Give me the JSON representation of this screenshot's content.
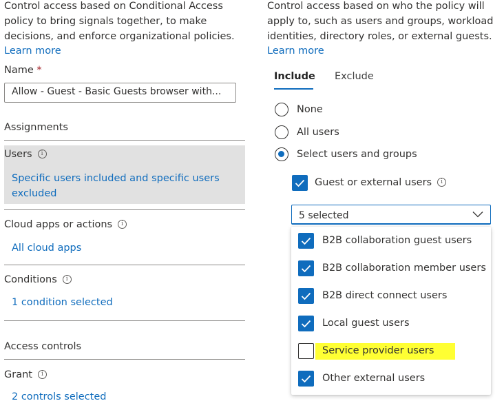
{
  "left": {
    "description": [
      "Control access based on Conditional Access",
      "policy to bring signals together, to make",
      "decisions, and enforce organizational policies."
    ],
    "learn_more": "Learn more",
    "name_label": "Name",
    "required_mark": "*",
    "name_value": "Allow - Guest - Basic Guests browser with...",
    "assignments": "Assignments",
    "users": {
      "label": "Users",
      "value_line1": "Specific users included and specific users",
      "value_line2": "excluded"
    },
    "cloud_apps": {
      "label": "Cloud apps or actions",
      "value": "All cloud apps"
    },
    "conditions": {
      "label": "Conditions",
      "value": "1 condition selected"
    },
    "access_controls": "Access controls",
    "grant": {
      "label": "Grant",
      "value": "2 controls selected"
    }
  },
  "right": {
    "description": [
      "Control access based on who the policy will",
      "apply to, such as users and groups, workload",
      "identities, directory roles, or external guests."
    ],
    "learn_more": "Learn more",
    "tabs": [
      {
        "label": "Include",
        "active": true
      },
      {
        "label": "Exclude",
        "active": false
      }
    ],
    "radios": [
      {
        "label": "None",
        "selected": false
      },
      {
        "label": "All users",
        "selected": false
      },
      {
        "label": "Select users and groups",
        "selected": true
      }
    ],
    "guest_checkbox": {
      "label": "Guest or external users",
      "checked": true
    },
    "dropdown": {
      "value": "5 selected"
    },
    "options": [
      {
        "label": "B2B collaboration guest users",
        "checked": true
      },
      {
        "label": "B2B collaboration member users",
        "checked": true
      },
      {
        "label": "B2B direct connect users",
        "checked": true
      },
      {
        "label": "Local guest users",
        "checked": true
      },
      {
        "label": "Service provider users",
        "checked": false
      },
      {
        "label": "Other external users",
        "checked": true
      }
    ]
  },
  "colors": {
    "accent": "#0f6cbd",
    "highlight": "#ffff33",
    "selected_bg": "#e1e1e1"
  }
}
